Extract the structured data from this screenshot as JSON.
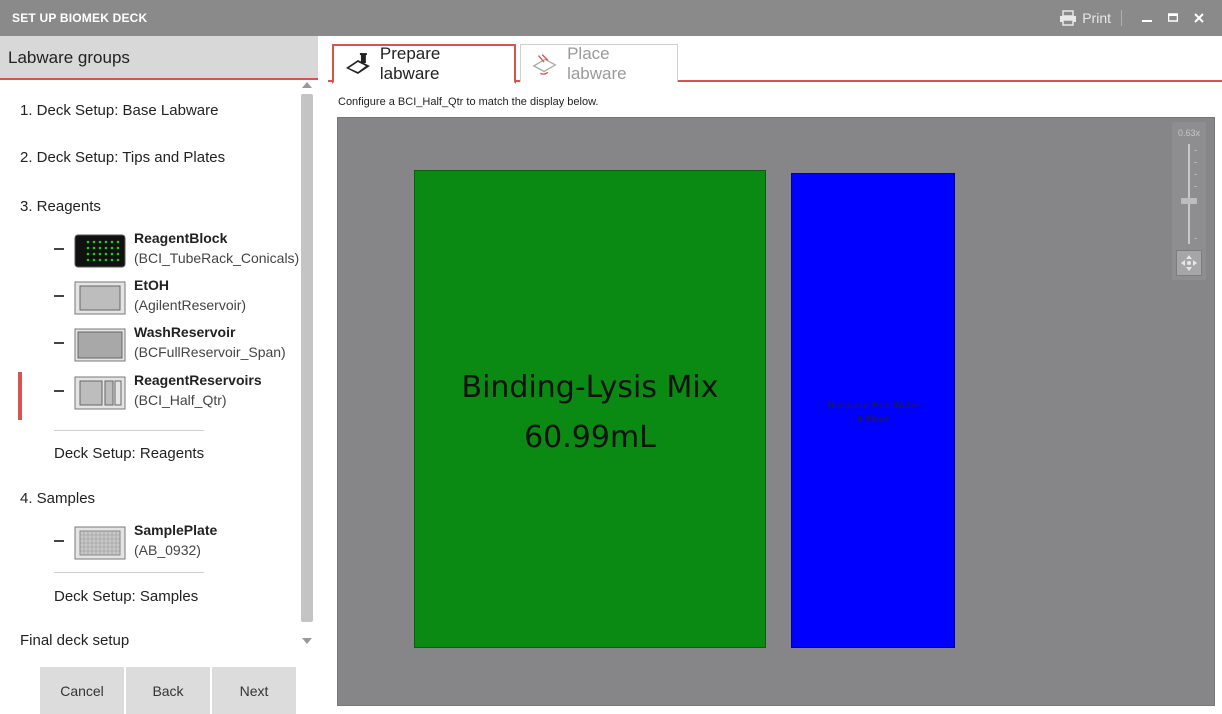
{
  "window": {
    "title": "SET UP BIOMEK DECK",
    "print_label": "Print"
  },
  "left_panel": {
    "header": "Labware groups",
    "groups": [
      {
        "label": "1. Deck Setup: Base Labware"
      },
      {
        "label": "2. Deck Setup: Tips and Plates"
      },
      {
        "label": "3. Reagents"
      },
      {
        "label": "4. Samples"
      },
      {
        "label": "Final deck setup"
      }
    ],
    "reagent_items": [
      {
        "name": "ReagentBlock",
        "type": "(BCI_TubeRack_Conicals)"
      },
      {
        "name": "EtOH",
        "type": "(AgilentReservoir)"
      },
      {
        "name": "WashReservoir",
        "type": "(BCFullReservoir_Span)"
      },
      {
        "name": "ReagentReservoirs",
        "type": "(BCI_Half_Qtr)"
      }
    ],
    "reagents_setup": "Deck Setup: Reagents",
    "sample_items": [
      {
        "name": "SamplePlate",
        "type": "(AB_0932)"
      }
    ],
    "samples_setup": "Deck Setup: Samples",
    "buttons": {
      "cancel": "Cancel",
      "back": "Back",
      "next": "Next"
    }
  },
  "tabs": {
    "prepare": "Prepare labware",
    "place": "Place labware"
  },
  "instruction": "Configure a BCI_Half_Qtr to match the display below.",
  "deck": {
    "reservoir1": {
      "name": "Binding-Lysis Mix",
      "volume": "60.99mL",
      "color": "#0b8a13"
    },
    "reservoir2": {
      "name": "Nuclease-Free Water",
      "volume": "6.86mL",
      "color": "#0000ff"
    },
    "zoom_label": "0.63x"
  }
}
